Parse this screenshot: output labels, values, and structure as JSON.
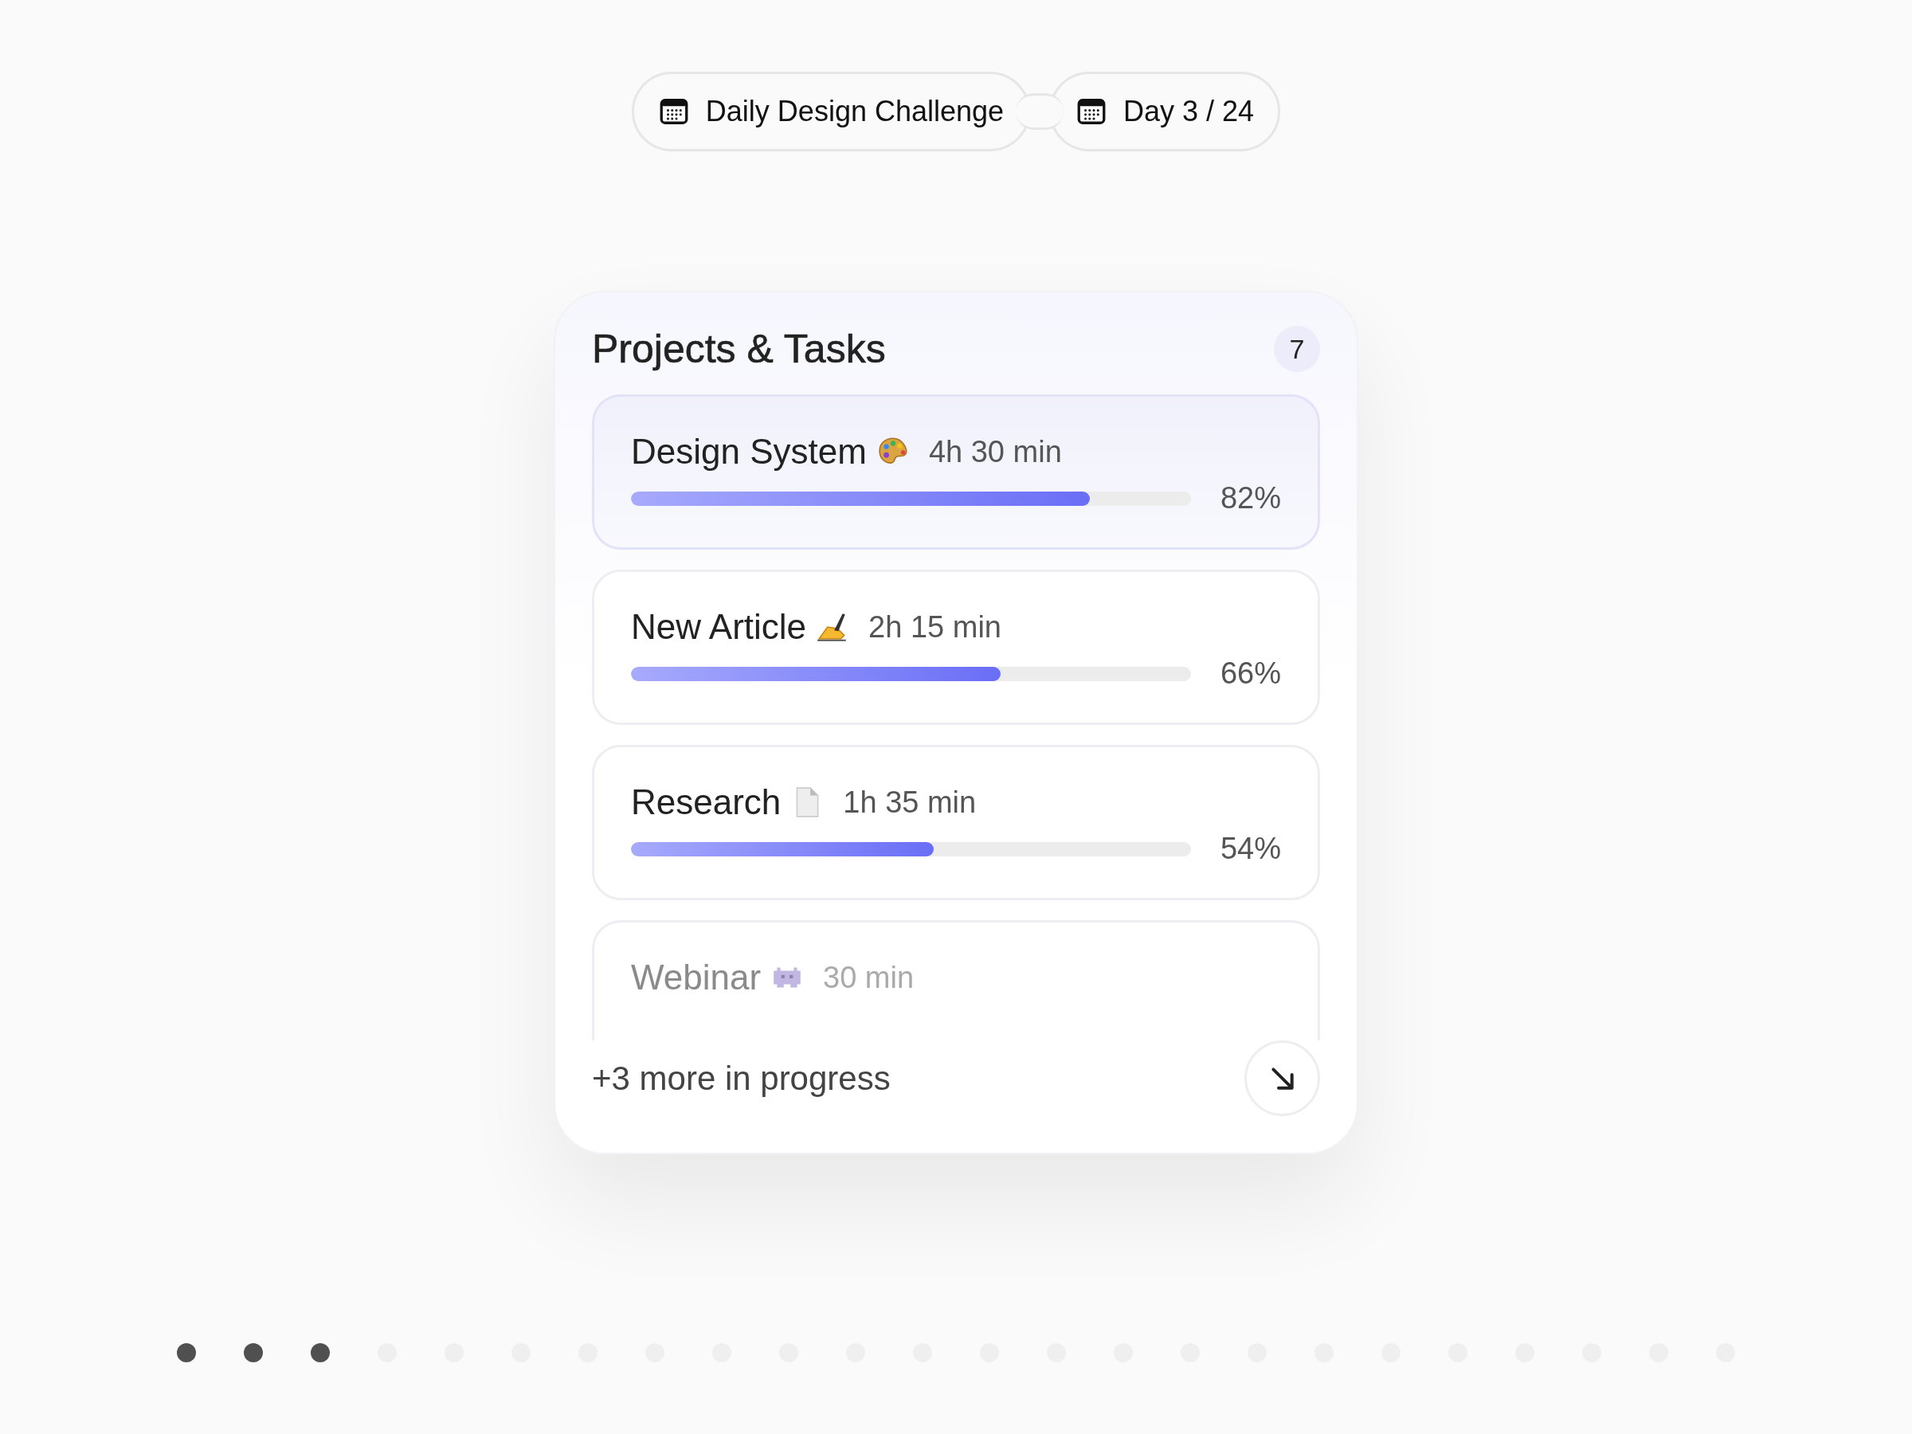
{
  "header": {
    "challenge": "Daily Design Challenge",
    "day": "Day 3 / 24"
  },
  "card": {
    "title": "Projects & Tasks",
    "count": "7",
    "tasks": [
      {
        "name": "Design System",
        "duration": "4h 30 min",
        "level": 0.82,
        "percent": "82%",
        "selected": true,
        "faded": false
      },
      {
        "name": "New Article",
        "duration": "2h 15 min",
        "level": 0.66,
        "percent": "66%",
        "selected": false,
        "faded": false
      },
      {
        "name": "Research",
        "duration": "1h 35 min",
        "level": 0.54,
        "percent": "54%",
        "selected": false,
        "faded": false
      },
      {
        "name": "Webinar",
        "duration": "30 min",
        "selected": false,
        "faded": true
      }
    ],
    "footer": "+3 more in progress"
  },
  "progress_dots": [
    {
      "done": true
    },
    {
      "done": true
    },
    {
      "done": true
    },
    {
      "done": false
    },
    {
      "done": false
    },
    {
      "done": false
    },
    {
      "done": false
    },
    {
      "done": false
    },
    {
      "done": false
    },
    {
      "done": false
    },
    {
      "done": false
    },
    {
      "done": false
    },
    {
      "done": false
    },
    {
      "done": false
    },
    {
      "done": false
    },
    {
      "done": false
    },
    {
      "done": false
    },
    {
      "done": false
    },
    {
      "done": false
    },
    {
      "done": false
    },
    {
      "done": false
    },
    {
      "done": false
    },
    {
      "done": false
    },
    {
      "done": false
    }
  ]
}
